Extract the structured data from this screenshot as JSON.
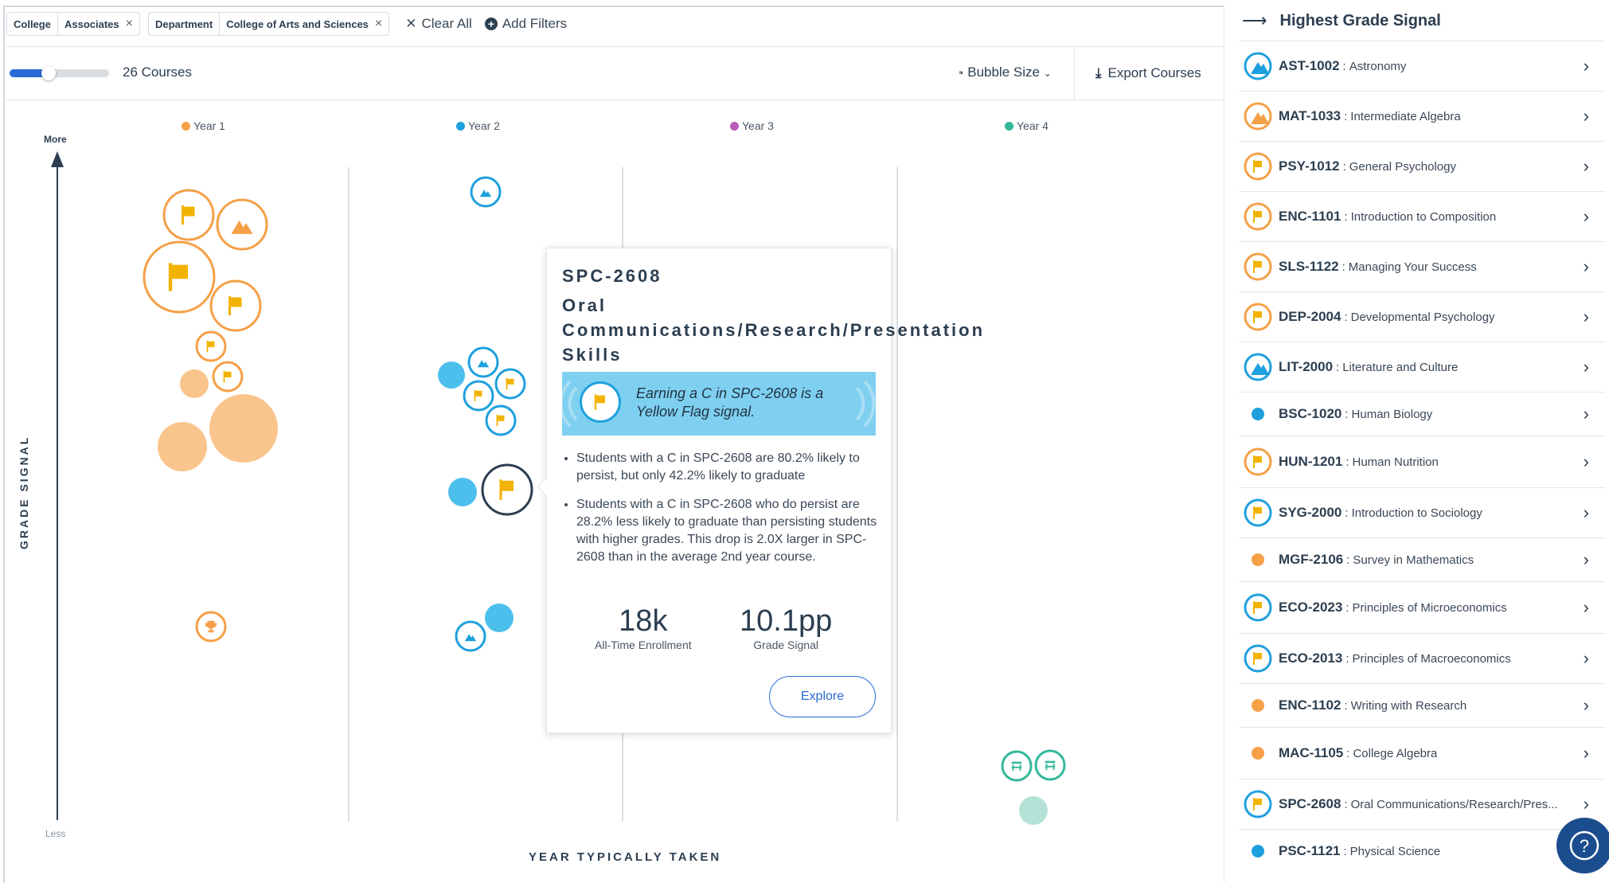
{
  "filters": {
    "chips": [
      {
        "key": "College",
        "value": "Associates"
      },
      {
        "key": "Department",
        "value": "College of Arts and Sciences"
      }
    ],
    "clear_all": "Clear All",
    "add_filters": "Add Filters"
  },
  "toolbar": {
    "course_count": "26 Courses",
    "bubble_size": "Bubble Size",
    "export": "Export Courses",
    "slider_fill_fraction": 0.5
  },
  "chart": {
    "years": [
      {
        "label": "Year 1",
        "color": "#f5a047"
      },
      {
        "label": "Year 2",
        "color": "#1fa0de"
      },
      {
        "label": "Year 3",
        "color": "#b75db7"
      },
      {
        "label": "Year 4",
        "color": "#33b89a"
      }
    ],
    "y_axis_title": "GRADE SIGNAL",
    "x_axis_title": "YEAR TYPICALLY TAKEN",
    "more": "More",
    "less": "Less"
  },
  "tooltip": {
    "code": "SPC-2608",
    "title": "Oral Communications/Research/Presentation Skills",
    "signal_text": "Earning a C in SPC-2608 is a Yellow Flag signal.",
    "bullets": [
      "Students with a C in SPC-2608 are 80.2% likely to persist, but only 42.2% likely to graduate",
      "Students with a C in SPC-2608 who do persist are 28.2% less likely to graduate than persisting students with higher grades. This drop is 2.0X larger in SPC-2608 than in the average 2nd year course."
    ],
    "metrics": [
      {
        "value": "18k",
        "caption": "All-Time Enrollment"
      },
      {
        "value": "10.1pp",
        "caption": "Grade Signal"
      }
    ],
    "explore": "Explore"
  },
  "panel": {
    "title": "Highest Grade Signal",
    "rows": [
      {
        "code": "AST-1002",
        "name": "Astronomy",
        "icon": "mountain-icon",
        "color": "#1fa0de",
        "ring": true
      },
      {
        "code": "MAT-1033",
        "name": "Intermediate Algebra",
        "icon": "mountain-icon",
        "color": "#f5a047",
        "ring": true
      },
      {
        "code": "PSY-1012",
        "name": "General Psychology",
        "icon": "flag-icon",
        "color": "#f5a047",
        "ring": true
      },
      {
        "code": "ENC-1101",
        "name": "Introduction to Composition",
        "icon": "flag-icon",
        "color": "#f5a047",
        "ring": true
      },
      {
        "code": "SLS-1122",
        "name": "Managing Your Success",
        "icon": "flag-icon",
        "color": "#f5a047",
        "ring": true
      },
      {
        "code": "DEP-2004",
        "name": "Developmental Psychology",
        "icon": "flag-icon",
        "color": "#f5a047",
        "ring": true
      },
      {
        "code": "LIT-2000",
        "name": "Literature and Culture",
        "icon": "mountain-icon",
        "color": "#1fa0de",
        "ring": true
      },
      {
        "code": "BSC-1020",
        "name": "Human Biology",
        "icon": "dot-icon",
        "color": "#1fa0de",
        "ring": false
      },
      {
        "code": "HUN-1201",
        "name": "Human Nutrition",
        "icon": "flag-icon",
        "color": "#f5a047",
        "ring": true
      },
      {
        "code": "SYG-2000",
        "name": "Introduction to Sociology",
        "icon": "flag-icon",
        "color": "#1fa0de",
        "ring": true
      },
      {
        "code": "MGF-2106",
        "name": "Survey in Mathematics",
        "icon": "dot-icon",
        "color": "#f5a047",
        "ring": false
      },
      {
        "code": "ECO-2023",
        "name": "Principles of Microeconomics",
        "icon": "flag-icon",
        "color": "#1fa0de",
        "ring": true
      },
      {
        "code": "ECO-2013",
        "name": "Principles of Macroeconomics",
        "icon": "flag-icon",
        "color": "#1fa0de",
        "ring": true
      },
      {
        "code": "ENC-1102",
        "name": "Writing with Research",
        "icon": "dot-icon",
        "color": "#f5a047",
        "ring": false
      },
      {
        "code": "MAC-1105",
        "name": "College Algebra",
        "icon": "dot-icon",
        "color": "#f5a047",
        "ring": false
      },
      {
        "code": "SPC-2608",
        "name": "Oral Communications/Research/Pres...",
        "icon": "flag-icon",
        "color": "#1fa0de",
        "ring": true
      },
      {
        "code": "PSC-1121",
        "name": "Physical Science",
        "icon": "dot-icon",
        "color": "#1fa0de",
        "ring": false
      }
    ]
  }
}
